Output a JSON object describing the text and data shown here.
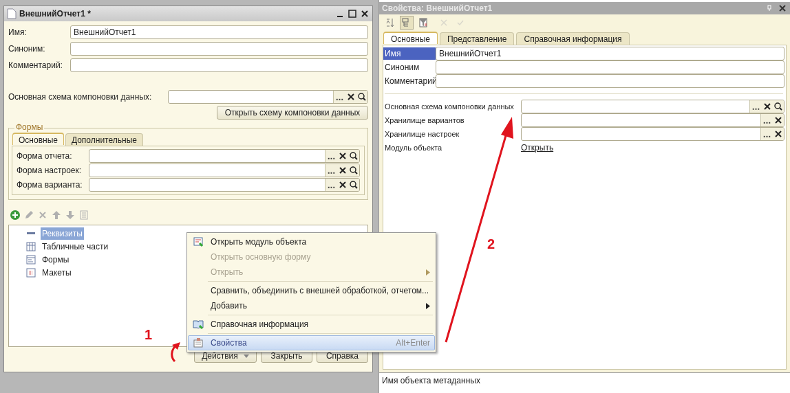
{
  "left_window": {
    "title": "ВнешнийОтчет1 *",
    "fields": [
      {
        "label": "Имя:",
        "value": "ВнешнийОтчет1"
      },
      {
        "label": "Синоним:"
      },
      {
        "label": "Комментарий:"
      }
    ],
    "schema": {
      "label": "Основная схема компоновки данных:",
      "button": "Открыть схему компоновки данных"
    },
    "forms_group": {
      "title": "Формы",
      "tabs": [
        {
          "label": "Основные",
          "selected": true
        },
        {
          "label": "Дополнительные",
          "selected": false
        }
      ],
      "fields": [
        {
          "label": "Форма отчета:"
        },
        {
          "label": "Форма настроек:"
        },
        {
          "label": "Форма варианта:"
        }
      ]
    },
    "toolbar": [
      {
        "kind": "add",
        "disabled": false
      },
      {
        "kind": "edit",
        "disabled": true
      },
      {
        "kind": "delete",
        "disabled": true
      },
      {
        "kind": "up",
        "disabled": true
      },
      {
        "kind": "down",
        "disabled": true
      },
      {
        "kind": "list",
        "disabled": true
      }
    ],
    "tree": [
      {
        "label": "Реквизиты",
        "kind": "attribute",
        "selected": true
      },
      {
        "label": "Табличные части",
        "kind": "table",
        "selected": false
      },
      {
        "label": "Формы",
        "kind": "form",
        "selected": false
      },
      {
        "label": "Макеты",
        "kind": "template",
        "selected": false
      }
    ],
    "buttons": [
      {
        "label": "Действия",
        "dropdown": true
      },
      {
        "label": "Закрыть",
        "dropdown": false
      },
      {
        "label": "Справка",
        "dropdown": false
      }
    ]
  },
  "context_menu": [
    {
      "kind": "module",
      "label": "Открыть модуль объекта",
      "disabled": false,
      "submenu": false,
      "selected": false
    },
    {
      "kind": "plain",
      "label": "Открыть основную форму",
      "disabled": true,
      "submenu": false,
      "selected": false
    },
    {
      "kind": "plain",
      "label": "Открыть",
      "disabled": true,
      "submenu": true,
      "selected": false
    },
    {
      "kind": "separator"
    },
    {
      "kind": "plain",
      "label": "Сравнить, объединить с внешней обработкой, отчетом...",
      "disabled": false,
      "submenu": false,
      "selected": false
    },
    {
      "kind": "plain",
      "label": "Добавить",
      "disabled": false,
      "submenu": true,
      "selected": false
    },
    {
      "kind": "separator"
    },
    {
      "kind": "help",
      "label": "Справочная информация",
      "disabled": false,
      "submenu": false,
      "selected": false
    },
    {
      "kind": "separator"
    },
    {
      "kind": "properties",
      "label": "Свойства",
      "shortcut": "Alt+Enter",
      "disabled": false,
      "submenu": false,
      "selected": true
    }
  ],
  "properties": {
    "title": "Свойства: ВнешнийОтчет1",
    "toolbar": [
      {
        "kind": "sort",
        "pressed": false,
        "disabled": false
      },
      {
        "kind": "tree",
        "pressed": true,
        "disabled": false
      },
      {
        "kind": "filter",
        "pressed": false,
        "disabled": false
      },
      {
        "kind": "cancel",
        "pressed": false,
        "disabled": true
      },
      {
        "kind": "ok",
        "pressed": false,
        "disabled": true
      }
    ],
    "tabs": [
      {
        "label": "Основные",
        "selected": true
      },
      {
        "label": "Представление",
        "selected": false
      },
      {
        "label": "Справочная информация",
        "selected": false
      }
    ],
    "rows": [
      {
        "label": "Имя",
        "value": "ВнешнийОтчет1",
        "selected": true
      },
      {
        "label": "Синоним",
        "selected": false
      },
      {
        "label": "Комментарий",
        "selected": false
      }
    ],
    "rows2": [
      {
        "kind": "lookup",
        "label": "Основная схема компоновки данных"
      },
      {
        "kind": "storage",
        "label": "Хранилище вариантов"
      },
      {
        "kind": "storage",
        "label": "Хранилище настроек"
      },
      {
        "kind": "link",
        "label": "Модуль объекта",
        "link": "Открыть"
      }
    ],
    "status": "Имя объекта метаданных"
  },
  "annotations": [
    {
      "label": "1",
      "kind": "curved"
    },
    {
      "label": "2",
      "kind": "straight"
    }
  ]
}
